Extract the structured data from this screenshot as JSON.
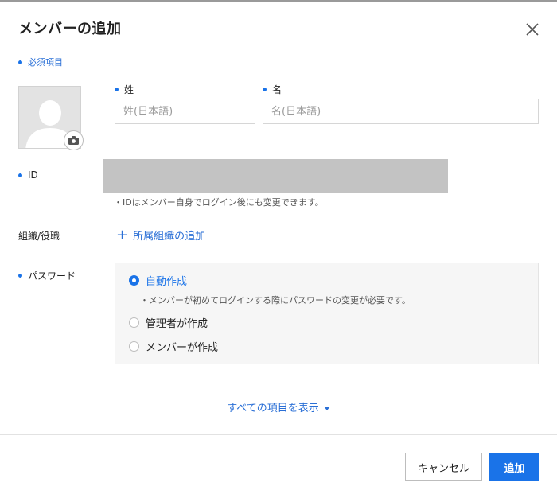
{
  "dialog": {
    "title": "メンバーの追加",
    "required_note": "必須項目"
  },
  "name": {
    "last_label": "姓",
    "last_placeholder": "姓(日本語)",
    "last_value": "",
    "first_label": "名",
    "first_placeholder": "名(日本語)",
    "first_value": ""
  },
  "id_field": {
    "label": "ID",
    "note": "・IDはメンバー自身でログイン後にも変更できます。"
  },
  "org": {
    "label": "組織/役職",
    "add_link": "所属組織の追加"
  },
  "password": {
    "label": "パスワード",
    "options": [
      {
        "label": "自動作成",
        "selected": true
      },
      {
        "label": "管理者が作成",
        "selected": false
      },
      {
        "label": "メンバーが作成",
        "selected": false
      }
    ],
    "auto_note": "・メンバーが初めてログインする際にパスワードの変更が必要です。"
  },
  "show_all": "すべての項目を表示",
  "footer": {
    "cancel_label": "キャンセル",
    "add_label": "追加"
  },
  "colors": {
    "accent": "#1a73e8",
    "link": "#2a6fd6",
    "id_redaction": "#c3c3c3"
  },
  "icons": [
    "close-icon",
    "camera-icon",
    "avatar-placeholder-icon",
    "plus-icon",
    "caret-down-icon"
  ]
}
